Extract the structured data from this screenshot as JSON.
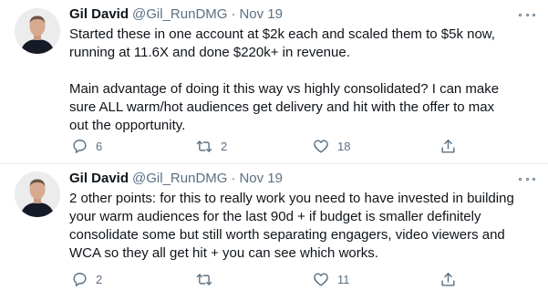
{
  "tweets": [
    {
      "author_name": "Gil David",
      "handle": "@Gil_RunDMG",
      "separator": "·",
      "date": "Nov 19",
      "text": "Started these in one account at $2k each and scaled them to $5k now,\nrunning at 11.6X and done $220k+ in revenue.\n\nMain advantage of doing it this way vs highly consolidated? I can make\nsure ALL warm/hot audiences get delivery and hit with the offer to max\nout the opportunity.",
      "replies": "6",
      "retweets": "2",
      "likes": "18"
    },
    {
      "author_name": "Gil David",
      "handle": "@Gil_RunDMG",
      "separator": "·",
      "date": "Nov 19",
      "text": "2 other points: for this to really work you need to have invested in building\nyour warm audiences for the last 90d + if budget is smaller definitely\nconsolidate some but still worth separating engagers, video viewers and\nWCA so they all get hit + you can see which works.",
      "replies": "2",
      "retweets": "",
      "likes": "11"
    }
  ],
  "icons": {
    "reply": "reply-icon",
    "retweet": "retweet-icon",
    "like": "heart-icon",
    "share": "share-icon",
    "more": "more-icon"
  },
  "colors": {
    "muted": "#5b7083",
    "text": "#0f1419",
    "divider": "#e6ecf0"
  }
}
